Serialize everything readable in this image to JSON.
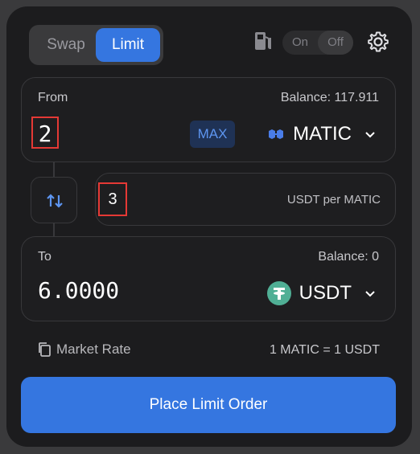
{
  "tabs": {
    "swap": "Swap",
    "limit": "Limit"
  },
  "gas_toggle": {
    "on": "On",
    "off": "Off"
  },
  "from": {
    "label": "From",
    "balance": "Balance: 117.911",
    "amount": "2",
    "max": "MAX",
    "token": "MATIC",
    "token_icon": "matic-icon"
  },
  "rate": {
    "value": "3",
    "unit": "USDT per MATIC"
  },
  "to": {
    "label": "To",
    "balance": "Balance: 0",
    "amount": "6.0000",
    "token": "USDT",
    "token_icon": "tether-icon"
  },
  "market": {
    "label": "Market Rate",
    "value": "1 MATIC = 1 USDT"
  },
  "submit": {
    "label": "Place Limit Order"
  },
  "colors": {
    "accent": "#3576e0",
    "highlight_border": "#e53935",
    "tether": "#50af95",
    "matic": "#4a7de8"
  }
}
